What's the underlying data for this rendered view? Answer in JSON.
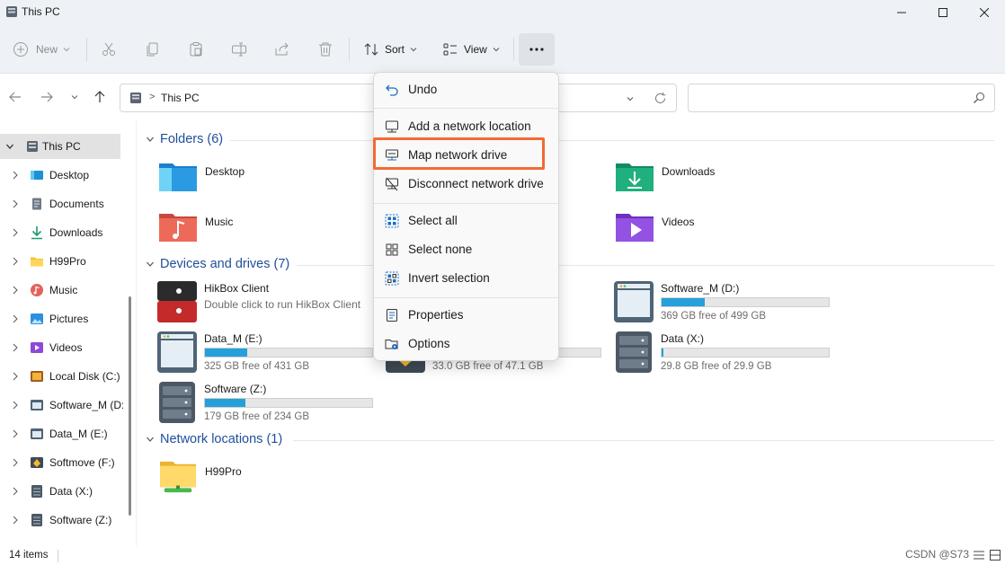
{
  "window": {
    "title": "This PC"
  },
  "toolbar": {
    "new_label": "New",
    "sort_label": "Sort",
    "view_label": "View"
  },
  "address": {
    "crumb": "This PC"
  },
  "search": {
    "placeholder": ""
  },
  "sidebar": {
    "items": [
      {
        "label": "This PC",
        "icon": "pc-icon",
        "selected": true
      },
      {
        "label": "Desktop",
        "icon": "desktop-icon"
      },
      {
        "label": "Documents",
        "icon": "documents-icon"
      },
      {
        "label": "Downloads",
        "icon": "downloads-icon"
      },
      {
        "label": "H99Pro",
        "icon": "folder-icon"
      },
      {
        "label": "Music",
        "icon": "music-icon"
      },
      {
        "label": "Pictures",
        "icon": "pictures-icon"
      },
      {
        "label": "Videos",
        "icon": "videos-icon"
      },
      {
        "label": "Local Disk (C:)",
        "icon": "drive-icon"
      },
      {
        "label": "Software_M (D:",
        "icon": "drive-icon"
      },
      {
        "label": "Data_M (E:)",
        "icon": "drive-icon"
      },
      {
        "label": "Softmove (F:)",
        "icon": "drive-icon"
      },
      {
        "label": "Data (X:)",
        "icon": "server-drive-icon"
      },
      {
        "label": "Software (Z:)",
        "icon": "server-drive-icon"
      }
    ]
  },
  "sections": {
    "folders": "Folders (6)",
    "devices": "Devices and drives (7)",
    "network": "Network locations (1)"
  },
  "folders": [
    {
      "name": "Desktop"
    },
    {
      "name": "Downloads"
    },
    {
      "name": "Music"
    },
    {
      "name": "Videos"
    }
  ],
  "drives": {
    "hikbox": {
      "name": "HikBox Client",
      "sub": "Double click to run HikBox Client"
    },
    "software_m": {
      "name": "Software_M (D:)",
      "free": "369 GB free of 499 GB",
      "used_fraction": 0.26
    },
    "data_m": {
      "name": "Data_M (E:)",
      "free": "325 GB free of 431 GB",
      "used_fraction": 0.25
    },
    "softmove": {
      "free": "33.0 GB free of 47.1 GB",
      "used_fraction": 0.3
    },
    "data_x": {
      "name": "Data (X:)",
      "free": "29.8 GB free of 29.9 GB",
      "used_fraction": 0.01
    },
    "software_z": {
      "name": "Software (Z:)",
      "free": "179 GB free of 234 GB",
      "used_fraction": 0.24
    }
  },
  "network": [
    {
      "name": "H99Pro"
    }
  ],
  "menu": {
    "items": [
      {
        "label": "Undo",
        "icon": "undo-icon"
      },
      {
        "label": "Add a network location",
        "icon": "network-location-icon"
      },
      {
        "label": "Map network drive",
        "icon": "map-drive-icon",
        "highlighted": true
      },
      {
        "label": "Disconnect network drive",
        "icon": "disconnect-drive-icon"
      },
      {
        "label": "Select all",
        "icon": "select-all-icon"
      },
      {
        "label": "Select none",
        "icon": "select-none-icon"
      },
      {
        "label": "Invert selection",
        "icon": "invert-selection-icon"
      },
      {
        "label": "Properties",
        "icon": "properties-icon"
      },
      {
        "label": "Options",
        "icon": "options-icon"
      }
    ]
  },
  "status": {
    "items": "14 items",
    "watermark": "CSDN @S73"
  },
  "colors": {
    "accent": "#26a0da",
    "highlight_border": "#f26a35",
    "section_header": "#1f4e9a"
  }
}
